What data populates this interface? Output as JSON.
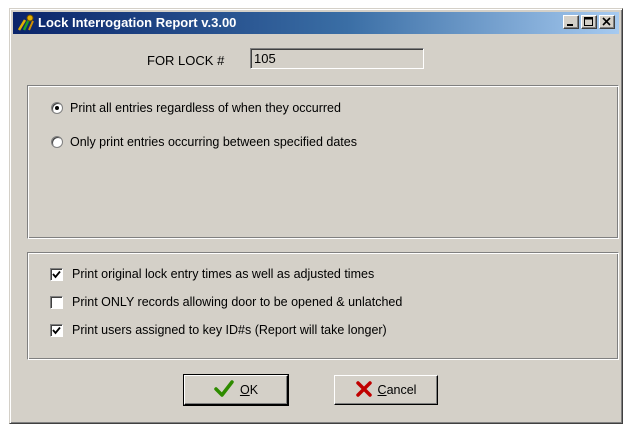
{
  "window": {
    "title": "Lock Interrogation Report v.3.00"
  },
  "lock": {
    "label": "FOR LOCK #",
    "value": "105"
  },
  "date_range": {
    "options": [
      {
        "label": "Print all entries regardless of when they occurred",
        "selected": true
      },
      {
        "label": "Only print entries occurring between specified dates",
        "selected": false
      }
    ]
  },
  "options": {
    "items": [
      {
        "label": "Print original lock entry times as well as adjusted times",
        "checked": true
      },
      {
        "label": "Print ONLY records allowing door to be opened & unlatched",
        "checked": false
      },
      {
        "label": "Print users assigned to key ID#s (Report will take longer)",
        "checked": true
      }
    ]
  },
  "buttons": {
    "ok_label_first": "O",
    "ok_label_rest": "K",
    "cancel_label_first": "C",
    "cancel_label_rest": "ancel"
  },
  "icons": {
    "app": "key-icon",
    "ok": "checkmark-icon",
    "cancel": "x-icon"
  },
  "colors": {
    "titlebar_start": "#0a246a",
    "titlebar_end": "#a6caf0",
    "face": "#d4d0c8",
    "ok_check": "#2e8b00",
    "cancel_x": "#c00000"
  }
}
